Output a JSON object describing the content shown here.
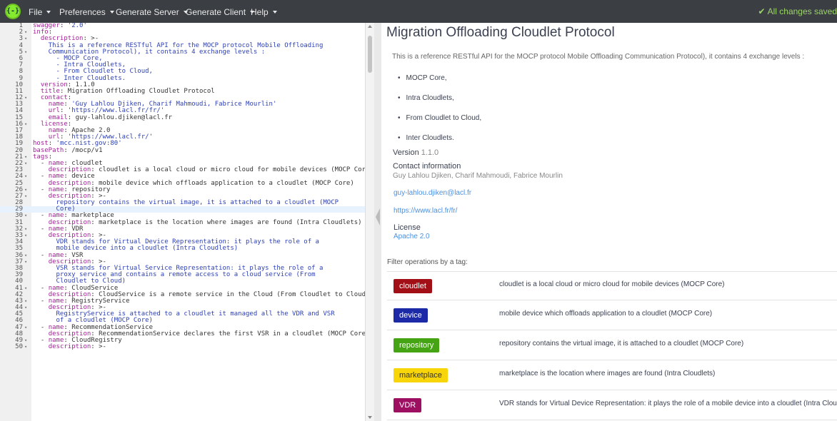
{
  "topbar": {
    "logo_text": "{-}",
    "menus": [
      "File",
      "Preferences",
      "Generate Server",
      "Generate Client",
      "Help"
    ],
    "status": "All changes saved"
  },
  "editor": {
    "active_line": 29,
    "lines": [
      {
        "n": "1",
        "f": "",
        "t": "swagger: '2.0'"
      },
      {
        "n": "2",
        "f": "▾",
        "t": "info:"
      },
      {
        "n": "3",
        "f": "▾",
        "t": "  description: >-"
      },
      {
        "n": "4",
        "f": "",
        "t": "    This is a reference RESTful API for the MOCP protocol Mobile Offloading"
      },
      {
        "n": "5",
        "f": "▾",
        "t": "    Communication Protocol), it contains 4 exchange levels :"
      },
      {
        "n": "6",
        "f": "",
        "t": "      - MOCP Core,"
      },
      {
        "n": "7",
        "f": "",
        "t": "      - Intra Cloudlets,"
      },
      {
        "n": "8",
        "f": "",
        "t": "      - From Cloudlet to Cloud,"
      },
      {
        "n": "9",
        "f": "",
        "t": "      - Inter Cloudlets."
      },
      {
        "n": "10",
        "f": "",
        "t": "  version: 1.1.0"
      },
      {
        "n": "11",
        "f": "",
        "t": "  title: Migration Offloading Cloudlet Protocol"
      },
      {
        "n": "12",
        "f": "▾",
        "t": "  contact:"
      },
      {
        "n": "13",
        "f": "",
        "t": "    name: 'Guy Lahlou Djiken, Charif Mahmoudi, Fabrice Mourlin'"
      },
      {
        "n": "14",
        "f": "",
        "t": "    url: 'https://www.lacl.fr/fr/'"
      },
      {
        "n": "15",
        "f": "",
        "t": "    email: guy-lahlou.djiken@lacl.fr"
      },
      {
        "n": "16",
        "f": "▾",
        "t": "  license:"
      },
      {
        "n": "17",
        "f": "",
        "t": "    name: Apache 2.0"
      },
      {
        "n": "18",
        "f": "",
        "t": "    url: 'https://www.lacl.fr/'"
      },
      {
        "n": "19",
        "f": "",
        "t": "host: 'mcc.nist.gov:80'"
      },
      {
        "n": "20",
        "f": "",
        "t": "basePath: /mocp/v1"
      },
      {
        "n": "21",
        "f": "▾",
        "t": "tags:"
      },
      {
        "n": "22",
        "f": "▾",
        "t": "  - name: cloudlet"
      },
      {
        "n": "23",
        "f": "",
        "t": "    description: cloudlet is a local cloud or micro cloud for mobile devices (MOCP Core)"
      },
      {
        "n": "24",
        "f": "▾",
        "t": "  - name: device"
      },
      {
        "n": "25",
        "f": "",
        "t": "    description: mobile device which offloads application to a cloudlet (MOCP Core)"
      },
      {
        "n": "26",
        "f": "▾",
        "t": "  - name: repository"
      },
      {
        "n": "27",
        "f": "▾",
        "t": "    description: >-"
      },
      {
        "n": "28",
        "f": "",
        "t": "      repository contains the virtual image, it is attached to a cloudlet (MOCP"
      },
      {
        "n": "29",
        "f": "",
        "t": "      Core)"
      },
      {
        "n": "30",
        "f": "▾",
        "t": "  - name: marketplace"
      },
      {
        "n": "31",
        "f": "",
        "t": "    description: marketplace is the location where images are found (Intra Cloudlets)"
      },
      {
        "n": "32",
        "f": "▾",
        "t": "  - name: VDR"
      },
      {
        "n": "33",
        "f": "▾",
        "t": "    description: >-"
      },
      {
        "n": "34",
        "f": "",
        "t": "      VDR stands for Virtual Device Representation: it plays the role of a"
      },
      {
        "n": "35",
        "f": "",
        "t": "      mobile device into a cloudlet (Intra Cloudlets)"
      },
      {
        "n": "36",
        "f": "▾",
        "t": "  - name: VSR"
      },
      {
        "n": "37",
        "f": "▾",
        "t": "    description: >-"
      },
      {
        "n": "38",
        "f": "",
        "t": "      VSR stands for Virtual Service Representation: it plays the role of a"
      },
      {
        "n": "39",
        "f": "",
        "t": "      proxy service and contains a remote access to a cloud service (From"
      },
      {
        "n": "40",
        "f": "",
        "t": "      Cloudlet to Cloud)"
      },
      {
        "n": "41",
        "f": "▾",
        "t": "  - name: CloudService"
      },
      {
        "n": "42",
        "f": "",
        "t": "    description: CloudService is a remote service in the Cloud (From Cloudlet to Cloud)"
      },
      {
        "n": "43",
        "f": "▾",
        "t": "  - name: RegistryService"
      },
      {
        "n": "44",
        "f": "▾",
        "t": "    description: >-"
      },
      {
        "n": "45",
        "f": "",
        "t": "      RegistryService is attached to a cloudlet it managed all the VDR and VSR"
      },
      {
        "n": "46",
        "f": "",
        "t": "      of a cloudlet (MOCP Core)"
      },
      {
        "n": "47",
        "f": "▾",
        "t": "  - name: RecommendationService"
      },
      {
        "n": "48",
        "f": "",
        "t": "    description: RecommendationService declares the first VSR in a cloudlet (MOCP Core)"
      },
      {
        "n": "49",
        "f": "▾",
        "t": "  - name: CloudRegistry"
      },
      {
        "n": "50",
        "f": "▾",
        "t": "    description: >-"
      }
    ]
  },
  "preview": {
    "title": "Migration Offloading Cloudlet Protocol",
    "description": "This is a reference RESTful API for the MOCP protocol Mobile Offloading Communication Protocol), it contains 4 exchange levels :",
    "bullets": [
      "MOCP Core,",
      "Intra Cloudlets,",
      "From Cloudlet to Cloud,",
      "Inter Cloudlets."
    ],
    "version_label": "Version",
    "version": "1.1.0",
    "contact_heading": "Contact information",
    "contact_names": "Guy Lahlou Djiken, Charif Mahmoudi, Fabrice Mourlin",
    "contact_email": "guy-lahlou.djiken@lacl.fr",
    "contact_url": "https://www.lacl.fr/fr/",
    "license_heading": "License",
    "license_name": "Apache 2.0",
    "filter_label": "Filter operations by a tag:",
    "tags": [
      {
        "name": "cloudlet",
        "color": "#a30f16",
        "description": "cloudlet is a local cloud or micro cloud for mobile devices (MOCP Core)"
      },
      {
        "name": "device",
        "color": "#1d2aa8",
        "description": "mobile device which offloads application to a cloudlet (MOCP Core)"
      },
      {
        "name": "repository",
        "color": "#44a413",
        "description": "repository contains the virtual image, it is attached to a cloudlet (MOCP Core)"
      },
      {
        "name": "marketplace",
        "color": "#f8d509",
        "description": "marketplace is the location where images are found (Intra Cloudlets)"
      },
      {
        "name": "VDR",
        "color": "#9c0f61",
        "description": "VDR stands for Virtual Device Representation: it plays the role of a mobile device into a cloudlet (Intra Cloudlets)"
      }
    ]
  }
}
